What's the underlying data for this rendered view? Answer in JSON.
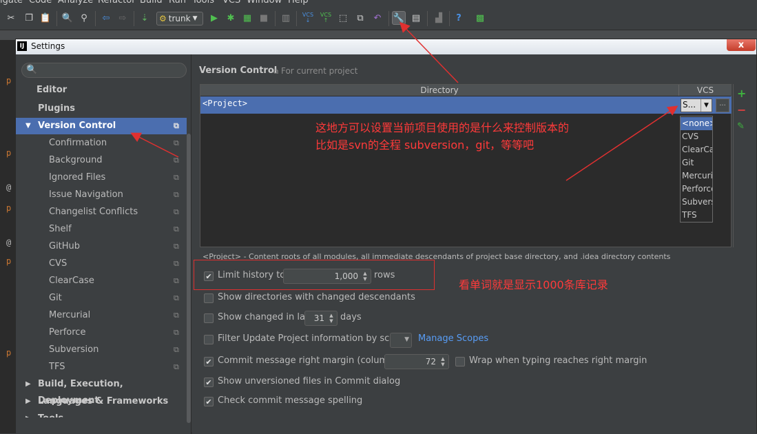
{
  "menubar": [
    "igate",
    "Code",
    "Analyze",
    "Refactor",
    "Build",
    "Run",
    "Tools",
    "VCS",
    "Window",
    "Help"
  ],
  "toolbar": {
    "branch": "trunk",
    "vcs_label": "VCS"
  },
  "dialog": {
    "title": "Settings",
    "logo": "IJ",
    "close": "x"
  },
  "tree": {
    "items": [
      {
        "label": "Editor"
      },
      {
        "label": "Plugins"
      },
      {
        "label": "Version Control"
      },
      {
        "label": "Confirmation"
      },
      {
        "label": "Background"
      },
      {
        "label": "Ignored Files"
      },
      {
        "label": "Issue Navigation"
      },
      {
        "label": "Changelist Conflicts"
      },
      {
        "label": "Shelf"
      },
      {
        "label": "GitHub"
      },
      {
        "label": "CVS"
      },
      {
        "label": "ClearCase"
      },
      {
        "label": "Git"
      },
      {
        "label": "Mercurial"
      },
      {
        "label": "Perforce"
      },
      {
        "label": "Subversion"
      },
      {
        "label": "TFS"
      },
      {
        "label": "Build, Execution, Deployment"
      },
      {
        "label": "Languages & Frameworks"
      },
      {
        "label": "Tools"
      }
    ]
  },
  "pane": {
    "title": "Version Control",
    "subtitle": "For current project",
    "table": {
      "col_directory": "Directory",
      "col_vcs": "VCS",
      "row_project": "<Project>",
      "vcs_selected": "S...",
      "dots": "..."
    },
    "vcs_options": [
      "<none>",
      "CVS",
      "ClearCase",
      "Git",
      "Mercurial",
      "Perforce",
      "Subversion",
      "TFS"
    ],
    "note": "<Project> - Content roots of all modules, all immediate descendants of project base directory, and .idea directory contents",
    "options": {
      "limit_history": "Limit history to:",
      "limit_value": "1,000",
      "limit_unit": "rows",
      "show_dirs": "Show directories with changed descendants",
      "show_changed": "Show changed in last",
      "show_changed_value": "31",
      "show_changed_unit": "days",
      "filter_update": "Filter Update Project information by scope",
      "manage_scopes": "Manage Scopes",
      "commit_margin": "Commit message right margin (columns):",
      "commit_margin_value": "72",
      "wrap_typing": "Wrap when typing reaches right margin",
      "show_unversioned": "Show unversioned files in Commit dialog",
      "check_spelling": "Check commit message spelling"
    }
  },
  "annotations": {
    "vcs_note_line1": "这地方可以设置当前项目使用的是什么来控制版本的",
    "vcs_note_line2": "比如是svn的全程 subversion，git，等等吧",
    "history_note": "看单词就是显示1000条库记录"
  },
  "colors": {
    "selection": "#4b6eaf",
    "link": "#589df6",
    "annotation_red": "#ff3a3a",
    "add_green": "#3fb33f",
    "remove_red": "#d94040"
  }
}
